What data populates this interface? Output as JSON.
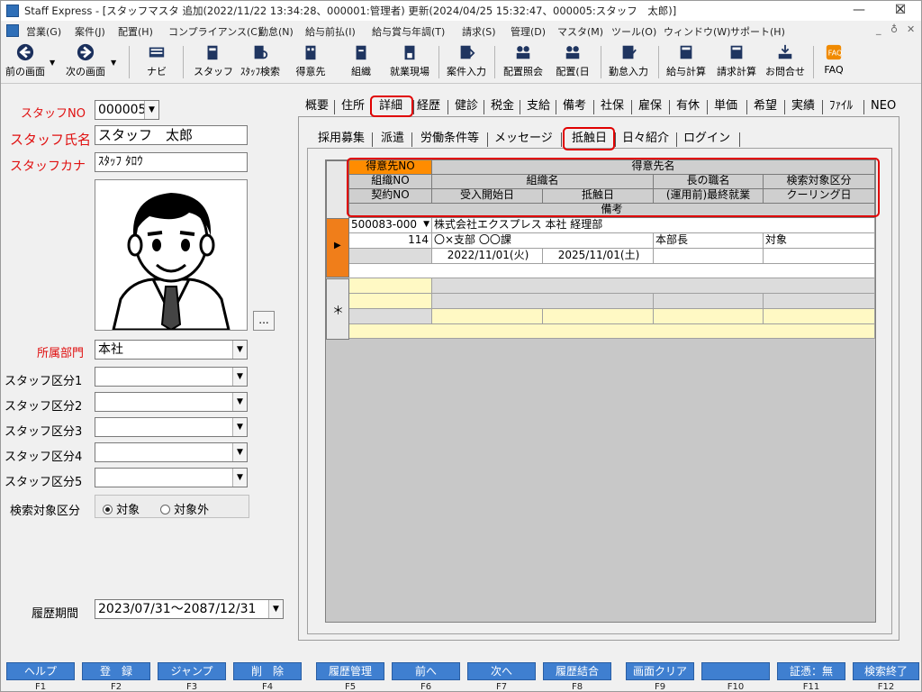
{
  "window": {
    "title": "Staff Express - [スタッフマスタ 追加(2022/11/22 13:34:28、000001:管理者) 更新(2024/04/25 15:32:47、000005:スタッフ　太郎)]",
    "controls": [
      "—",
      "☐",
      "✕"
    ]
  },
  "menu": {
    "items": [
      "営業(G)",
      "案件(J)",
      "配置(H)",
      "コンプライアンス(C)",
      "勤怠(N)",
      "給与前払(I)",
      "給与賞与年調(T)",
      "請求(S)",
      "管理(D)",
      "マスタ(M)",
      "ツール(O)",
      "ウィンドウ(W)",
      "サポート(H)"
    ],
    "mdi_controls": [
      "_",
      "♁",
      "✕"
    ]
  },
  "toolbar": {
    "prev": "前の画面",
    "next": "次の画面",
    "buttons": [
      "ナビ",
      "スタッフ",
      "ｽﾀｯﾌ検索",
      "得意先",
      "組織",
      "就業現場",
      "案件入力",
      "配置照会",
      "配置(日",
      "勤怠入力",
      "給与計算",
      "請求計算",
      "お問合せ",
      "FAQ"
    ]
  },
  "left": {
    "staff_no_label": "スタッフNO",
    "staff_no_value": "000005",
    "staff_name_label": "スタッフ氏名",
    "staff_name_value": "スタッフ　太郎",
    "staff_kana_label": "スタッフカナ",
    "staff_kana_value": "ｽﾀｯﾌ ﾀﾛｳ",
    "photo_button": "...",
    "dept_label": "所属部門",
    "dept_value": "本社",
    "categories": [
      "スタッフ区分1",
      "スタッフ区分2",
      "スタッフ区分3",
      "スタッフ区分4",
      "スタッフ区分5"
    ],
    "search_label": "検索対象区分",
    "search_options": [
      "対象",
      "対象外"
    ],
    "history_label": "履歴期間",
    "history_value": "2023/07/31～2087/12/31"
  },
  "tabs": {
    "main": [
      "概要",
      "住所",
      "詳細",
      "経歴",
      "健診",
      "税金",
      "支給",
      "備考",
      "社保",
      "雇保",
      "有休",
      "単価",
      "希望",
      "実績",
      "ﾌｧｲﾙ",
      "NEO"
    ],
    "sub": [
      "採用募集",
      "派遣",
      "労働条件等",
      "メッセージ",
      "抵触日",
      "日々紹介",
      "ログイン"
    ]
  },
  "grid": {
    "header": {
      "customer_no": "得意先NO",
      "customer_name": "得意先名",
      "org_no": "組織NO",
      "org_name": "組織名",
      "head_title": "長の職名",
      "search_target": "検索対象区分",
      "contract_no": "契約NO",
      "start_date": "受入開始日",
      "conflict_date": "抵触日",
      "last_work": "(運用前)最終就業",
      "cooling_date": "クーリング日",
      "note": "備考"
    },
    "row": {
      "customer_no": "500083-000",
      "customer_name": "株式会社エクスプレス 本社 経理部",
      "org_no": "114",
      "org_name": "〇×支部 〇〇課",
      "head_title": "本部長",
      "search_target": "対象",
      "start_date": "2022/11/01(火)",
      "conflict_date": "2025/11/01(土)"
    },
    "row_marker": "▶",
    "new_marker": "＊"
  },
  "fkeys": {
    "labels": [
      "ヘルプ",
      "登　録",
      "ジャンプ",
      "削　除",
      "履歴管理",
      "前へ",
      "次へ",
      "履歴結合",
      "画面クリア",
      "",
      "証憑：無",
      "検索終了"
    ],
    "keys": [
      "F1",
      "F2",
      "F3",
      "F4",
      "F5",
      "F6",
      "F7",
      "F8",
      "F9",
      "F10",
      "F11",
      "F12"
    ]
  },
  "colors": {
    "accent_red": "#e01010",
    "fkey_blue": "#3f7fd0",
    "grid_header_highlight": "#ff8c00",
    "grid_yellow": "#fff9c4"
  }
}
